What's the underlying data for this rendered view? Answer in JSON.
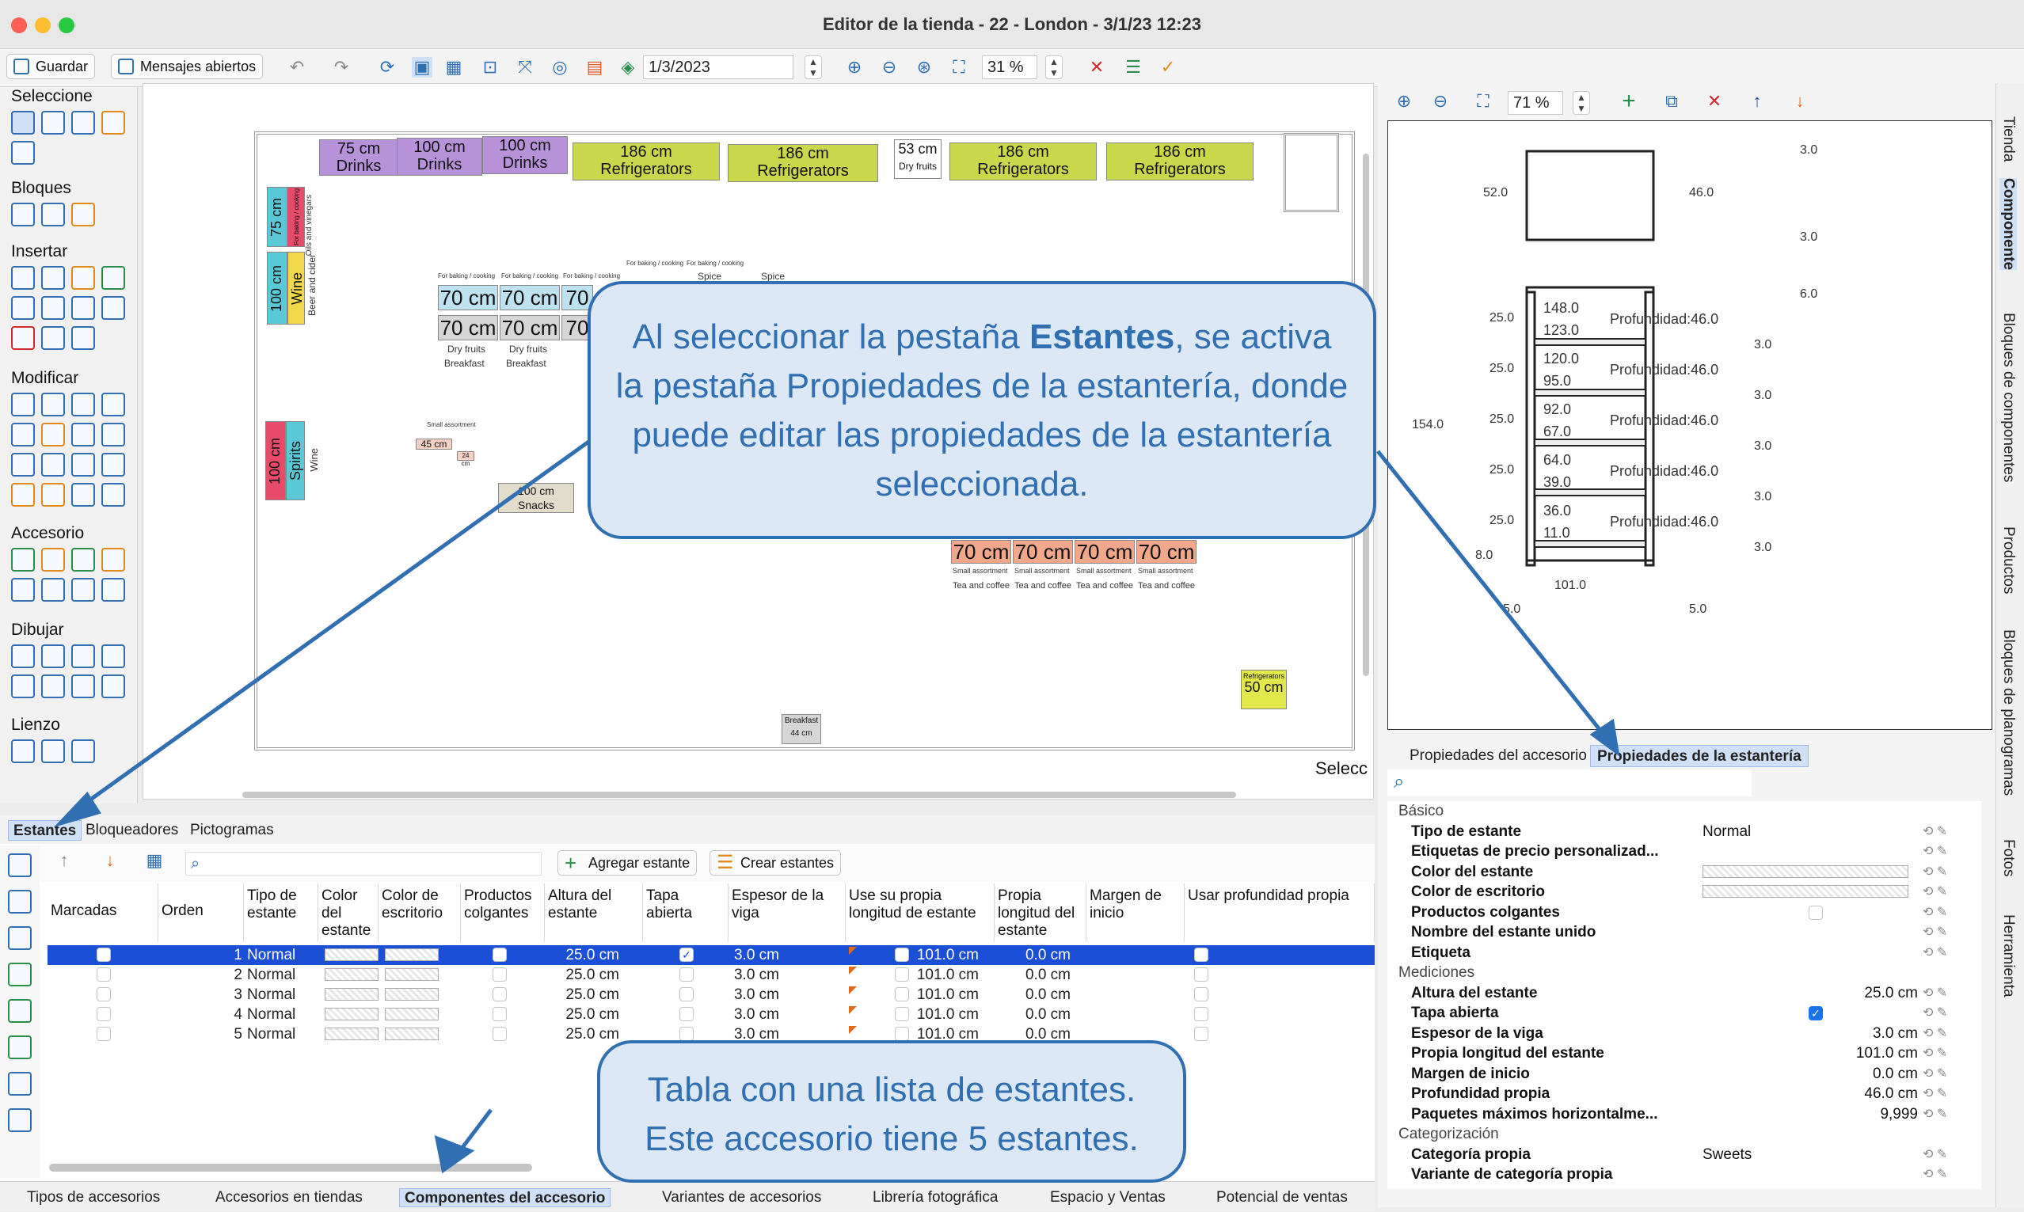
{
  "window": {
    "title": "Editor de la tienda - 22 - London - 3/1/23 12:23"
  },
  "toolbar": {
    "save": "Guardar",
    "messages": "Mensajes abiertos",
    "date": "1/3/2023",
    "zoom": "31 %"
  },
  "palette": {
    "select": "Seleccione",
    "blocks": "Bloques",
    "insert": "Insertar",
    "modify": "Modificar",
    "accessory": "Accesorio",
    "draw": "Dibujar",
    "canvas": "Lienzo"
  },
  "canvas": {
    "fixtures": [
      {
        "l1": "75 cm",
        "l2": "Drinks"
      },
      {
        "l1": "100 cm",
        "l2": "Drinks"
      },
      {
        "l1": "100 cm",
        "l2": "Drinks"
      },
      {
        "l1": "186 cm",
        "l2": "Refrigerators"
      },
      {
        "l1": "186 cm",
        "l2": "Refrigerators"
      },
      {
        "l1": "53 cm",
        "l2": "Dry fruits"
      },
      {
        "l1": "186 cm",
        "l2": "Refrigerators"
      },
      {
        "l1": "186 cm",
        "l2": "Refrigerators"
      }
    ],
    "side": [
      {
        "l1": "75 cm",
        "l2": "For baking / cooking",
        "l3": "Oils and vinegars"
      },
      {
        "l1": "100 cm",
        "l2": "Wine",
        "l3": "Beer and cider"
      },
      {
        "l1": "100 cm",
        "l2": "Spirits",
        "l3": "Wine"
      }
    ],
    "mid_size": "70 cm",
    "mid_labels": [
      "Dry fruits",
      "Breakfast",
      "Dry fruits",
      "Breakfast"
    ],
    "mid_top": [
      "For baking / cooking",
      "For baking / cooking",
      "For baking / cooking",
      "For baking / cooking",
      "For baking / cooking",
      "Spice",
      "Spice"
    ],
    "tea_labels": [
      "Small assortment",
      "Tea and coffee"
    ],
    "snacks": {
      "l1": "100 cm",
      "l2": "Snacks"
    },
    "s45": "45 cm",
    "s24": "24 cm",
    "ref50": {
      "l1": "Refrigerators",
      "l2": "50 cm"
    },
    "breakfast": {
      "l1": "Breakfast",
      "l2": "44 cm"
    },
    "select_hint": "Selecc"
  },
  "callout_top": {
    "pre": "Al seleccionar la pestaña ",
    "bold": "Estantes",
    "post": ", se activa la pestaña Propiedades de la estantería, donde puede editar las propiedades de la estantería seleccionada."
  },
  "callout_bottom": {
    "text": "Tabla con una lista de estantes. Este accesorio tiene 5 estantes."
  },
  "right": {
    "zoom": "71 %",
    "dims": {
      "top_right1": "3.0",
      "left": "52.0",
      "right": "46.0",
      "top_right2": "3.0",
      "r6": "6.0",
      "h154": "154.0",
      "w101": "101.0",
      "b8": "8.0",
      "b5l": "5.0",
      "b5r": "5.0"
    },
    "shelves": [
      {
        "a": "148.0",
        "b": "123.0",
        "d": "Profundidad:46.0",
        "h": "25.0",
        "g": "3.0"
      },
      {
        "a": "120.0",
        "b": "95.0",
        "d": "Profundidad:46.0",
        "h": "25.0",
        "g": "3.0"
      },
      {
        "a": "92.0",
        "b": "67.0",
        "d": "Profundidad:46.0",
        "h": "25.0",
        "g": "3.0"
      },
      {
        "a": "64.0",
        "b": "39.0",
        "d": "Profundidad:46.0",
        "h": "25.0",
        "g": "3.0"
      },
      {
        "a": "36.0",
        "b": "11.0",
        "d": "Profundidad:46.0",
        "h": "25.0",
        "g": "3.0"
      }
    ],
    "tab1": "Propiedades del accesorio",
    "tab2": "Propiedades de la estantería",
    "props": [
      {
        "g": "Básico"
      },
      {
        "k": "Tipo de estante",
        "v": "Normal"
      },
      {
        "k": "Etiquetas de precio personalizad...",
        "v": ""
      },
      {
        "k": "Color del estante",
        "v": ""
      },
      {
        "k": "Color de escritorio",
        "v": ""
      },
      {
        "k": "Productos colgantes",
        "v": ""
      },
      {
        "k": "Nombre del estante unido",
        "v": ""
      },
      {
        "k": "Etiqueta",
        "v": ""
      },
      {
        "g": "Mediciones"
      },
      {
        "k": "Altura del estante",
        "n": "25.0 cm"
      },
      {
        "k": "Tapa abierta",
        "v": ""
      },
      {
        "k": "Espesor de la viga",
        "n": "3.0 cm"
      },
      {
        "k": "Propia longitud del estante",
        "n": "101.0 cm"
      },
      {
        "k": "Margen de inicio",
        "n": "0.0 cm"
      },
      {
        "k": "Profundidad propia",
        "n": "46.0 cm"
      },
      {
        "k": "Paquetes máximos horizontalme...",
        "n": "9,999"
      },
      {
        "g": "Categorización"
      },
      {
        "k": "Categoría propia",
        "v": "Sweets"
      },
      {
        "k": "Variante de categoría propia",
        "v": ""
      }
    ]
  },
  "rsidebar": [
    "Tienda",
    "Componente",
    "Bloques de componentes",
    "Productos",
    "Bloques de planogramas",
    "Fotos",
    "Herramienta"
  ],
  "bottom": {
    "tabs": [
      "Estantes",
      "Bloqueadores",
      "Pictogramas"
    ],
    "add": "Agregar estante",
    "create": "Crear estantes",
    "headers": [
      "Marcadas",
      "Orden",
      "Tipo de estante",
      "Color del estante",
      "Color de escritorio",
      "Productos colgantes",
      "Altura del estante",
      "Tapa abierta",
      "Espesor de la viga",
      "Use su propia longitud de estante",
      "Propia longitud del estante",
      "Margen de inicio",
      "Usar profundidad propia"
    ],
    "rows": [
      {
        "o": "1",
        "t": "Normal",
        "h": "25.0 cm",
        "e": "3.0 cm",
        "l": "101.0 cm",
        "m": "0.0 cm"
      },
      {
        "o": "2",
        "t": "Normal",
        "h": "25.0 cm",
        "e": "3.0 cm",
        "l": "101.0 cm",
        "m": "0.0 cm"
      },
      {
        "o": "3",
        "t": "Normal",
        "h": "25.0 cm",
        "e": "3.0 cm",
        "l": "101.0 cm",
        "m": "0.0 cm"
      },
      {
        "o": "4",
        "t": "Normal",
        "h": "25.0 cm",
        "e": "3.0 cm",
        "l": "101.0 cm",
        "m": "0.0 cm"
      },
      {
        "o": "5",
        "t": "Normal",
        "h": "25.0 cm",
        "e": "3.0 cm",
        "l": "101.0 cm",
        "m": "0.0 cm"
      }
    ]
  },
  "footer": [
    "Tipos de accesorios",
    "Accesorios en tiendas",
    "Componentes del accesorio",
    "Variantes de accesorios",
    "Librería fotográfica",
    "Espacio y Ventas",
    "Potencial de ventas"
  ]
}
